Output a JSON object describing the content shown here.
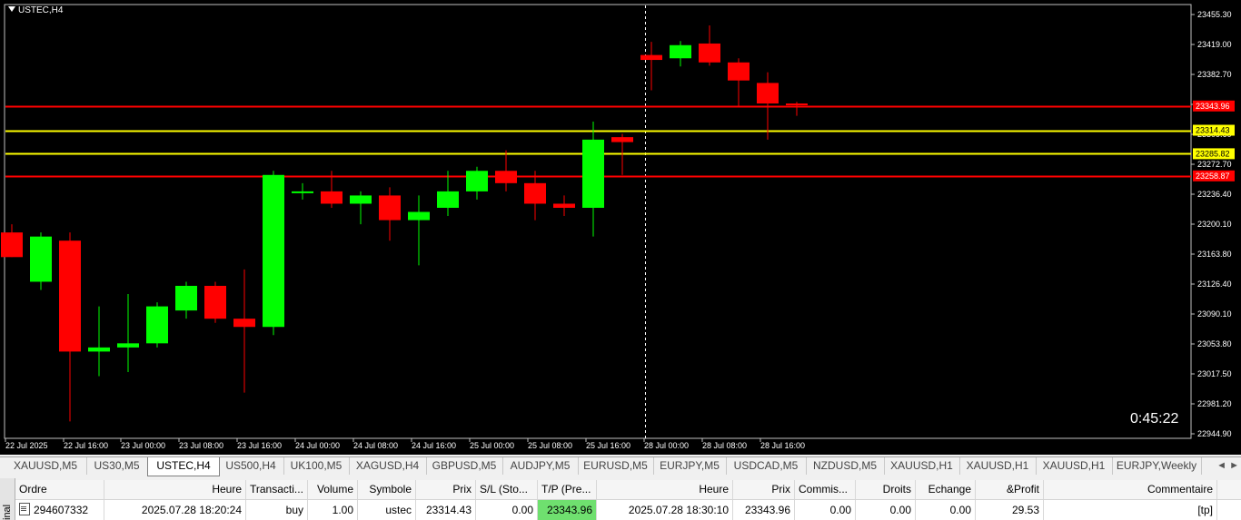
{
  "chart": {
    "symbol_label": "USTEC,H4",
    "countdown": "0:45:22",
    "price_axis": [
      "23455.30",
      "23419.00",
      "23382.70",
      "23346.40",
      "23309.60",
      "23272.70",
      "23236.40",
      "23200.10",
      "23163.80",
      "23126.40",
      "23090.10",
      "23053.80",
      "23017.50",
      "22981.20",
      "22944.90"
    ],
    "time_axis": [
      "22 Jul 2025",
      "22 Jul 16:00",
      "23 Jul 00:00",
      "23 Jul 08:00",
      "23 Jul 16:00",
      "24 Jul 00:00",
      "24 Jul 08:00",
      "24 Jul 16:00",
      "25 Jul 00:00",
      "25 Jul 08:00",
      "25 Jul 16:00",
      "28 Jul 00:00",
      "28 Jul 08:00",
      "28 Jul 16:00"
    ],
    "levels": [
      {
        "price": 23343.96,
        "label": "23343.96",
        "color": "#ff0000"
      },
      {
        "price": 23314.43,
        "label": "23314.43",
        "color": "#ffff00"
      },
      {
        "price": 23285.82,
        "label": "23285.82",
        "color": "#ffff00"
      },
      {
        "price": 23258.87,
        "label": "23258.87",
        "color": "#ff0000"
      }
    ],
    "colors": {
      "bull": "#00ff00",
      "bear": "#ff0000",
      "background": "#000000",
      "crosshair": "#ffffff"
    },
    "candles": [
      {
        "o": 23190,
        "h": 23200,
        "l": 23160,
        "c": 23160
      },
      {
        "o": 23130,
        "h": 23190,
        "l": 23120,
        "c": 23185
      },
      {
        "o": 23180,
        "h": 23190,
        "l": 22960,
        "c": 23045
      },
      {
        "o": 23045,
        "h": 23100,
        "l": 23015,
        "c": 23050
      },
      {
        "o": 23050,
        "h": 23115,
        "l": 23020,
        "c": 23055
      },
      {
        "o": 23055,
        "h": 23105,
        "l": 23050,
        "c": 23100
      },
      {
        "o": 23095,
        "h": 23130,
        "l": 23085,
        "c": 23125
      },
      {
        "o": 23125,
        "h": 23130,
        "l": 23080,
        "c": 23085
      },
      {
        "o": 23085,
        "h": 23145,
        "l": 22995,
        "c": 23075
      },
      {
        "o": 23075,
        "h": 23265,
        "l": 23065,
        "c": 23260
      },
      {
        "o": 23240,
        "h": 23250,
        "l": 23230,
        "c": 23240
      },
      {
        "o": 23240,
        "h": 23265,
        "l": 23220,
        "c": 23225
      },
      {
        "o": 23225,
        "h": 23240,
        "l": 23200,
        "c": 23235
      },
      {
        "o": 23235,
        "h": 23245,
        "l": 23180,
        "c": 23205
      },
      {
        "o": 23205,
        "h": 23235,
        "l": 23150,
        "c": 23215
      },
      {
        "o": 23220,
        "h": 23265,
        "l": 23210,
        "c": 23240
      },
      {
        "o": 23240,
        "h": 23270,
        "l": 23230,
        "c": 23265
      },
      {
        "o": 23265,
        "h": 23290,
        "l": 23240,
        "c": 23250
      },
      {
        "o": 23250,
        "h": 23265,
        "l": 23205,
        "c": 23225
      },
      {
        "o": 23225,
        "h": 23235,
        "l": 23210,
        "c": 23220
      },
      {
        "o": 23220,
        "h": 23325,
        "l": 23185,
        "c": 23303
      },
      {
        "o": 23306,
        "h": 23310,
        "l": 23260,
        "c": 23300
      },
      {
        "o": 23406,
        "h": 23422,
        "l": 23363,
        "c": 23400
      },
      {
        "o": 23402,
        "h": 23423,
        "l": 23392,
        "c": 23418
      },
      {
        "o": 23420,
        "h": 23442,
        "l": 23393,
        "c": 23397
      },
      {
        "o": 23397,
        "h": 23402,
        "l": 23344,
        "c": 23375
      },
      {
        "o": 23372,
        "h": 23385,
        "l": 23303,
        "c": 23347
      },
      {
        "o": 23347,
        "h": 23349,
        "l": 23332,
        "c": 23346
      }
    ]
  },
  "tabs": [
    "XAUUSD,M5",
    "US30,M5",
    "USTEC,H4",
    "US500,H4",
    "UK100,M5",
    "XAGUSD,H4",
    "GBPUSD,M5",
    "AUDJPY,M5",
    "EURUSD,M5",
    "EURJPY,M5",
    "USDCAD,M5",
    "NZDUSD,M5",
    "XAUUSD,H1",
    "XAUUSD,H1",
    "XAUUSD,H1",
    "EURJPY,Weekly"
  ],
  "active_tab": "USTEC,H4",
  "tab_scroll": "◄ ►",
  "side_label": "inal",
  "table": {
    "headers": {
      "ordre": "Ordre",
      "heure": "Heure",
      "transaction": "Transacti...",
      "volume": "Volume",
      "symbole": "Symbole",
      "prix": "Prix",
      "sl": "S/L (Sto...",
      "tp": "T/P (Pre...",
      "heure2": "Heure",
      "prix2": "Prix",
      "commission": "Commis...",
      "droits": "Droits",
      "echange": "Echange",
      "profit": "&Profit",
      "commentaire": "Commentaire"
    },
    "row": {
      "ordre": "294607332",
      "heure": "2025.07.28 18:20:24",
      "transaction": "buy",
      "volume": "1.00",
      "symbole": "ustec",
      "prix": "23314.43",
      "sl": "0.00",
      "tp": "23343.96",
      "heure2": "2025.07.28 18:30:10",
      "prix2": "23343.96",
      "commission": "0.00",
      "droits": "0.00",
      "echange": "0.00",
      "profit": "29.53",
      "commentaire": "[tp]"
    }
  }
}
